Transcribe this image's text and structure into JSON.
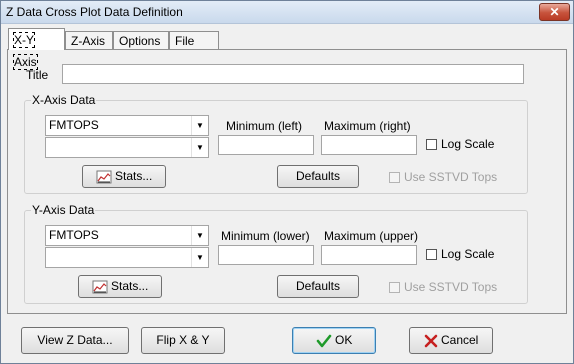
{
  "window": {
    "title": "Z Data Cross Plot Data Definition",
    "close_glyph": "✕"
  },
  "tabs": [
    {
      "label": "X-Y Axis",
      "active": true
    },
    {
      "label": "Z-Axis"
    },
    {
      "label": "Options"
    },
    {
      "label": "File"
    }
  ],
  "title_field": {
    "label": "Title",
    "value": ""
  },
  "x_axis": {
    "legend": "X-Axis Data",
    "combo1": "FMTOPS",
    "combo2": "",
    "min_label": "Minimum (left)",
    "max_label": "Maximum (right)",
    "min_value": "",
    "max_value": "",
    "log_scale_label": "Log Scale",
    "stats_label": "Stats...",
    "defaults_label": "Defaults",
    "sstvd_label": "Use SSTVD Tops"
  },
  "y_axis": {
    "legend": "Y-Axis Data",
    "combo1": "FMTOPS",
    "combo2": "",
    "min_label": "Minimum (lower)",
    "max_label": "Maximum (upper)",
    "min_value": "",
    "max_value": "",
    "log_scale_label": "Log Scale",
    "stats_label": "Stats...",
    "defaults_label": "Defaults",
    "sstvd_label": "Use SSTVD Tops"
  },
  "footer": {
    "view_z_label": "View Z Data...",
    "flip_label": "Flip X & Y",
    "ok_label": "OK",
    "cancel_label": "Cancel"
  },
  "colors": {
    "ok_check": "#1f9a2a",
    "cancel_x": "#c62020",
    "title_bar": "#c9d9ec"
  }
}
